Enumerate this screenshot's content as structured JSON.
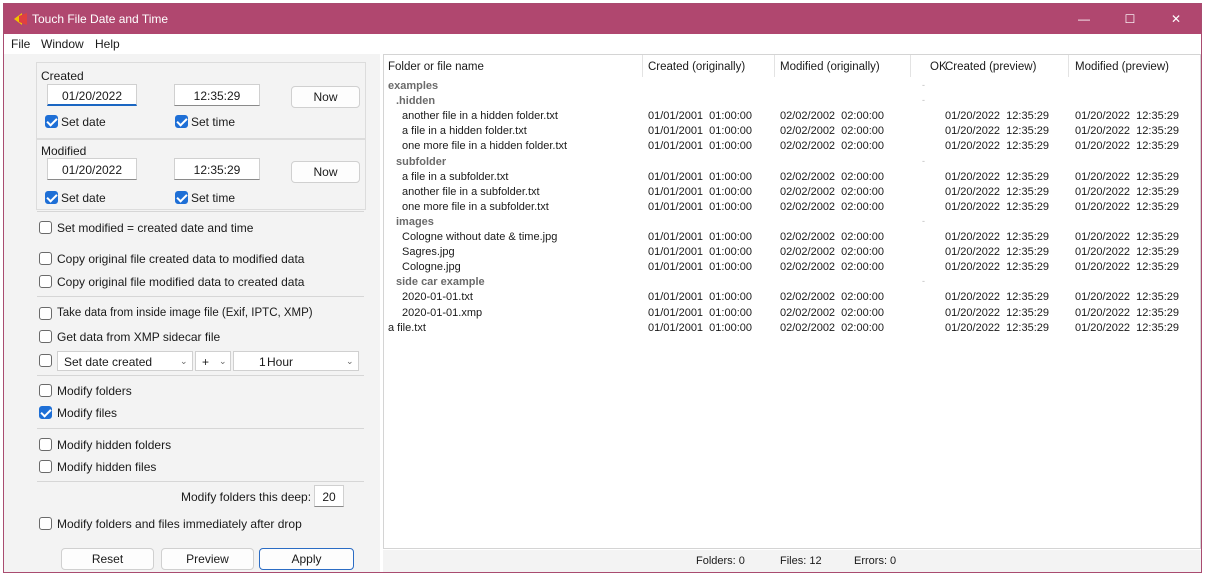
{
  "window": {
    "title": "Touch File Date and Time",
    "accent": "#b0476f"
  },
  "controls": {
    "minimize": "—",
    "maximize": "☐",
    "close": "✕"
  },
  "menu": [
    "File",
    "Window",
    "Help"
  ],
  "created": {
    "label": "Created",
    "date": "01/20/2022",
    "time": "12:35:29",
    "now": "Now",
    "set_date": "Set date",
    "set_time": "Set time"
  },
  "modified": {
    "label": "Modified",
    "date": "01/20/2022",
    "time": "12:35:29",
    "now": "Now",
    "set_date": "Set date",
    "set_time": "Set time"
  },
  "options": {
    "set_modified_eq_created": "Set modified = created date and time",
    "copy_created_to_modified": "Copy original file created data to modified data",
    "copy_modified_to_created": "Copy original file modified data to created data",
    "take_from_image": "Take data from inside image file (Exif, IPTC, XMP)",
    "xmp_sidecar": "Get data from XMP sidecar file",
    "offset_target": "Set date created",
    "offset_sign": "+",
    "offset_amount": "1",
    "offset_unit": "Hour",
    "modify_folders": "Modify folders",
    "modify_files": "Modify files",
    "modify_hidden_folders": "Modify hidden folders",
    "modify_hidden_files": "Modify hidden files",
    "depth_label": "Modify folders this deep:",
    "depth_value": "20",
    "immediate": "Modify folders and files immediately after drop"
  },
  "buttons": {
    "reset": "Reset",
    "preview": "Preview",
    "apply": "Apply"
  },
  "table": {
    "headers": [
      "Folder or file name",
      "Created (originally)",
      "Modified (originally)",
      "OK",
      "Created (preview)",
      "Modified (preview)"
    ],
    "rows": [
      {
        "name": "examples",
        "group": true,
        "indent": 0
      },
      {
        "name": ".hidden",
        "group": true,
        "indent": 1
      },
      {
        "name": "another file in a hidden folder.txt",
        "indent": 2,
        "co": "01/01/2001  01:00:00",
        "mo": "02/02/2002  02:00:00",
        "cp": "01/20/2022  12:35:29",
        "mp": "01/20/2022  12:35:29"
      },
      {
        "name": "a file in a hidden folder.txt",
        "indent": 2,
        "co": "01/01/2001  01:00:00",
        "mo": "02/02/2002  02:00:00",
        "cp": "01/20/2022  12:35:29",
        "mp": "01/20/2022  12:35:29"
      },
      {
        "name": "one more file in a hidden folder.txt",
        "indent": 2,
        "co": "01/01/2001  01:00:00",
        "mo": "02/02/2002  02:00:00",
        "cp": "01/20/2022  12:35:29",
        "mp": "01/20/2022  12:35:29"
      },
      {
        "name": "subfolder",
        "group": true,
        "indent": 1
      },
      {
        "name": "a file in a subfolder.txt",
        "indent": 2,
        "co": "01/01/2001  01:00:00",
        "mo": "02/02/2002  02:00:00",
        "cp": "01/20/2022  12:35:29",
        "mp": "01/20/2022  12:35:29"
      },
      {
        "name": "another file in a subfolder.txt",
        "indent": 2,
        "co": "01/01/2001  01:00:00",
        "mo": "02/02/2002  02:00:00",
        "cp": "01/20/2022  12:35:29",
        "mp": "01/20/2022  12:35:29"
      },
      {
        "name": "one more file in a subfolder.txt",
        "indent": 2,
        "co": "01/01/2001  01:00:00",
        "mo": "02/02/2002  02:00:00",
        "cp": "01/20/2022  12:35:29",
        "mp": "01/20/2022  12:35:29"
      },
      {
        "name": "images",
        "group": true,
        "indent": 1
      },
      {
        "name": "Cologne without date & time.jpg",
        "indent": 2,
        "co": "01/01/2001  01:00:00",
        "mo": "02/02/2002  02:00:00",
        "cp": "01/20/2022  12:35:29",
        "mp": "01/20/2022  12:35:29"
      },
      {
        "name": "Sagres.jpg",
        "indent": 2,
        "co": "01/01/2001  01:00:00",
        "mo": "02/02/2002  02:00:00",
        "cp": "01/20/2022  12:35:29",
        "mp": "01/20/2022  12:35:29"
      },
      {
        "name": "Cologne.jpg",
        "indent": 2,
        "co": "01/01/2001  01:00:00",
        "mo": "02/02/2002  02:00:00",
        "cp": "01/20/2022  12:35:29",
        "mp": "01/20/2022  12:35:29"
      },
      {
        "name": "side car example",
        "group": true,
        "indent": 1
      },
      {
        "name": "2020-01-01.txt",
        "indent": 2,
        "co": "01/01/2001  01:00:00",
        "mo": "02/02/2002  02:00:00",
        "cp": "01/20/2022  12:35:29",
        "mp": "01/20/2022  12:35:29"
      },
      {
        "name": "2020-01-01.xmp",
        "indent": 2,
        "co": "01/01/2001  01:00:00",
        "mo": "02/02/2002  02:00:00",
        "cp": "01/20/2022  12:35:29",
        "mp": "01/20/2022  12:35:29"
      },
      {
        "name": "a file.txt",
        "indent": 0,
        "co": "01/01/2001  01:00:00",
        "mo": "02/02/2002  02:00:00",
        "cp": "01/20/2022  12:35:29",
        "mp": "01/20/2022  12:35:29"
      }
    ]
  },
  "status": {
    "folders": "Folders: 0",
    "files": "Files: 12",
    "errors": "Errors: 0"
  }
}
